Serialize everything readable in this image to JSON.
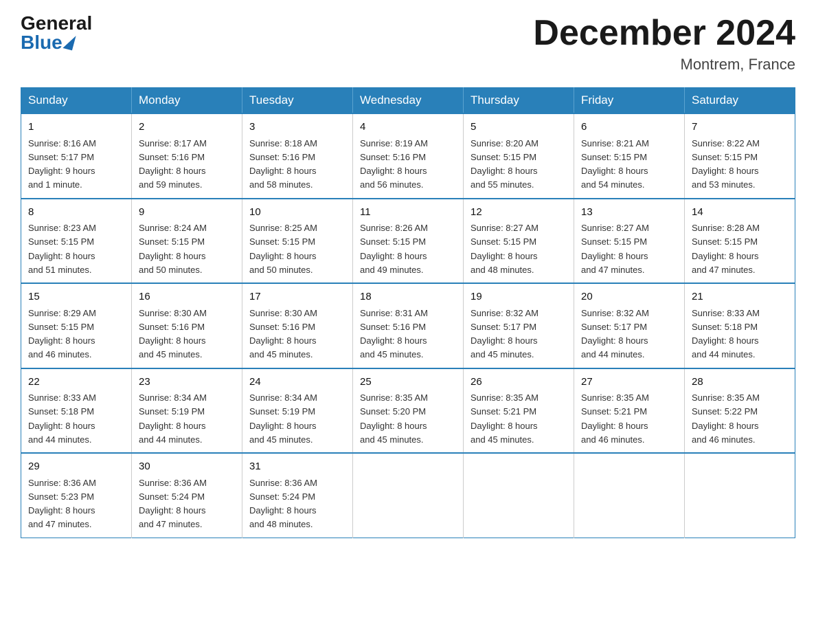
{
  "header": {
    "logo_general": "General",
    "logo_blue": "Blue",
    "title": "December 2024",
    "location": "Montrem, France"
  },
  "days_of_week": [
    "Sunday",
    "Monday",
    "Tuesday",
    "Wednesday",
    "Thursday",
    "Friday",
    "Saturday"
  ],
  "weeks": [
    [
      {
        "day": "1",
        "sunrise": "8:16 AM",
        "sunset": "5:17 PM",
        "daylight": "9 hours and 1 minute."
      },
      {
        "day": "2",
        "sunrise": "8:17 AM",
        "sunset": "5:16 PM",
        "daylight": "8 hours and 59 minutes."
      },
      {
        "day": "3",
        "sunrise": "8:18 AM",
        "sunset": "5:16 PM",
        "daylight": "8 hours and 58 minutes."
      },
      {
        "day": "4",
        "sunrise": "8:19 AM",
        "sunset": "5:16 PM",
        "daylight": "8 hours and 56 minutes."
      },
      {
        "day": "5",
        "sunrise": "8:20 AM",
        "sunset": "5:15 PM",
        "daylight": "8 hours and 55 minutes."
      },
      {
        "day": "6",
        "sunrise": "8:21 AM",
        "sunset": "5:15 PM",
        "daylight": "8 hours and 54 minutes."
      },
      {
        "day": "7",
        "sunrise": "8:22 AM",
        "sunset": "5:15 PM",
        "daylight": "8 hours and 53 minutes."
      }
    ],
    [
      {
        "day": "8",
        "sunrise": "8:23 AM",
        "sunset": "5:15 PM",
        "daylight": "8 hours and 51 minutes."
      },
      {
        "day": "9",
        "sunrise": "8:24 AM",
        "sunset": "5:15 PM",
        "daylight": "8 hours and 50 minutes."
      },
      {
        "day": "10",
        "sunrise": "8:25 AM",
        "sunset": "5:15 PM",
        "daylight": "8 hours and 50 minutes."
      },
      {
        "day": "11",
        "sunrise": "8:26 AM",
        "sunset": "5:15 PM",
        "daylight": "8 hours and 49 minutes."
      },
      {
        "day": "12",
        "sunrise": "8:27 AM",
        "sunset": "5:15 PM",
        "daylight": "8 hours and 48 minutes."
      },
      {
        "day": "13",
        "sunrise": "8:27 AM",
        "sunset": "5:15 PM",
        "daylight": "8 hours and 47 minutes."
      },
      {
        "day": "14",
        "sunrise": "8:28 AM",
        "sunset": "5:15 PM",
        "daylight": "8 hours and 47 minutes."
      }
    ],
    [
      {
        "day": "15",
        "sunrise": "8:29 AM",
        "sunset": "5:15 PM",
        "daylight": "8 hours and 46 minutes."
      },
      {
        "day": "16",
        "sunrise": "8:30 AM",
        "sunset": "5:16 PM",
        "daylight": "8 hours and 45 minutes."
      },
      {
        "day": "17",
        "sunrise": "8:30 AM",
        "sunset": "5:16 PM",
        "daylight": "8 hours and 45 minutes."
      },
      {
        "day": "18",
        "sunrise": "8:31 AM",
        "sunset": "5:16 PM",
        "daylight": "8 hours and 45 minutes."
      },
      {
        "day": "19",
        "sunrise": "8:32 AM",
        "sunset": "5:17 PM",
        "daylight": "8 hours and 45 minutes."
      },
      {
        "day": "20",
        "sunrise": "8:32 AM",
        "sunset": "5:17 PM",
        "daylight": "8 hours and 44 minutes."
      },
      {
        "day": "21",
        "sunrise": "8:33 AM",
        "sunset": "5:18 PM",
        "daylight": "8 hours and 44 minutes."
      }
    ],
    [
      {
        "day": "22",
        "sunrise": "8:33 AM",
        "sunset": "5:18 PM",
        "daylight": "8 hours and 44 minutes."
      },
      {
        "day": "23",
        "sunrise": "8:34 AM",
        "sunset": "5:19 PM",
        "daylight": "8 hours and 44 minutes."
      },
      {
        "day": "24",
        "sunrise": "8:34 AM",
        "sunset": "5:19 PM",
        "daylight": "8 hours and 45 minutes."
      },
      {
        "day": "25",
        "sunrise": "8:35 AM",
        "sunset": "5:20 PM",
        "daylight": "8 hours and 45 minutes."
      },
      {
        "day": "26",
        "sunrise": "8:35 AM",
        "sunset": "5:21 PM",
        "daylight": "8 hours and 45 minutes."
      },
      {
        "day": "27",
        "sunrise": "8:35 AM",
        "sunset": "5:21 PM",
        "daylight": "8 hours and 46 minutes."
      },
      {
        "day": "28",
        "sunrise": "8:35 AM",
        "sunset": "5:22 PM",
        "daylight": "8 hours and 46 minutes."
      }
    ],
    [
      {
        "day": "29",
        "sunrise": "8:36 AM",
        "sunset": "5:23 PM",
        "daylight": "8 hours and 47 minutes."
      },
      {
        "day": "30",
        "sunrise": "8:36 AM",
        "sunset": "5:24 PM",
        "daylight": "8 hours and 47 minutes."
      },
      {
        "day": "31",
        "sunrise": "8:36 AM",
        "sunset": "5:24 PM",
        "daylight": "8 hours and 48 minutes."
      },
      null,
      null,
      null,
      null
    ]
  ],
  "labels": {
    "sunrise": "Sunrise:",
    "sunset": "Sunset:",
    "daylight": "Daylight:"
  }
}
